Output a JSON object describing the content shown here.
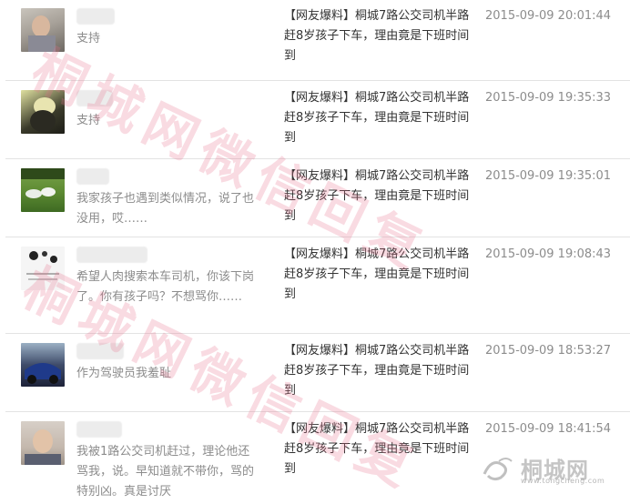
{
  "comments": [
    {
      "comment": "支持",
      "article": "【网友爆料】桐城7路公交司机半路赶8岁孩子下车，理由竟是下班时间到",
      "time": "2015-09-09 20:01:44"
    },
    {
      "comment": "支持",
      "article": "【网友爆料】桐城7路公交司机半路赶8岁孩子下车，理由竟是下班时间到",
      "time": "2015-09-09 19:35:33"
    },
    {
      "comment": "我家孩子也遇到类似情况，说了也没用，哎……",
      "article": "【网友爆料】桐城7路公交司机半路赶8岁孩子下车，理由竟是下班时间到",
      "time": "2015-09-09 19:35:01"
    },
    {
      "comment": "希望人肉搜索本车司机，你该下岗了。你有孩子吗？不想骂你……",
      "article": "【网友爆料】桐城7路公交司机半路赶8岁孩子下车，理由竟是下班时间到",
      "time": "2015-09-09 19:08:43"
    },
    {
      "comment": "作为驾驶员我羞耻",
      "article": "【网友爆料】桐城7路公交司机半路赶8岁孩子下车，理由竟是下班时间到",
      "time": "2015-09-09 18:53:27"
    },
    {
      "comment": "我被1路公交司机赶过，理论他还骂我，说。早知道就不带你，骂的特别凶。真是讨厌",
      "article": "【网友爆料】桐城7路公交司机半路赶8岁孩子下车，理由竟是下班时间到",
      "time": "2015-09-09 18:41:54"
    }
  ],
  "watermark": {
    "line1": "桐城网微信回复",
    "line2": "桐城网微信回复"
  },
  "logo": {
    "text": "桐城网",
    "sub": "www.tongcheng.com"
  }
}
